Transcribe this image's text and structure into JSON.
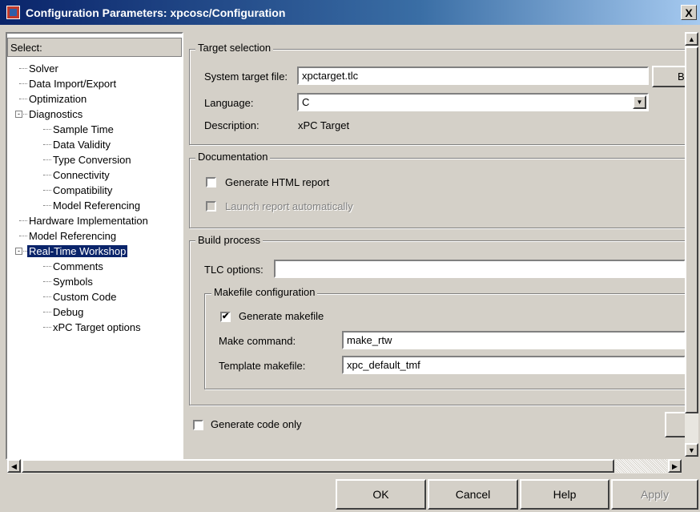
{
  "window": {
    "title": "Configuration Parameters: xpcosc/Configuration",
    "close_label": "X"
  },
  "tree": {
    "header": "Select:",
    "nodes": [
      {
        "label": "Solver"
      },
      {
        "label": "Data Import/Export"
      },
      {
        "label": "Optimization"
      },
      {
        "label": "Diagnostics",
        "expander": "-"
      },
      {
        "label": "Sample Time"
      },
      {
        "label": "Data Validity"
      },
      {
        "label": "Type Conversion"
      },
      {
        "label": "Connectivity"
      },
      {
        "label": "Compatibility"
      },
      {
        "label": "Model Referencing"
      },
      {
        "label": "Hardware Implementation"
      },
      {
        "label": "Model Referencing"
      },
      {
        "label": "Real-Time Workshop",
        "expander": "-",
        "selected": true
      },
      {
        "label": "Comments"
      },
      {
        "label": "Symbols"
      },
      {
        "label": "Custom Code"
      },
      {
        "label": "Debug"
      },
      {
        "label": "xPC Target options"
      }
    ]
  },
  "target_selection": {
    "legend": "Target selection",
    "system_target_label": "System target file:",
    "system_target_value": "xpctarget.tlc",
    "browse_label": "Br",
    "language_label": "Language:",
    "language_value": "C",
    "description_label": "Description:",
    "description_value": "xPC Target"
  },
  "documentation": {
    "legend": "Documentation",
    "generate_html_label": "Generate HTML report",
    "generate_html_checked": false,
    "launch_report_label": "Launch report automatically",
    "launch_report_checked": false
  },
  "build_process": {
    "legend": "Build process",
    "tlc_options_label": "TLC options:",
    "tlc_options_value": "",
    "makefile": {
      "legend": "Makefile configuration",
      "generate_makefile_label": "Generate makefile",
      "generate_makefile_mark": "✔",
      "make_command_label": "Make command:",
      "make_command_value": "make_rtw",
      "template_label": "Template makefile:",
      "template_value": "xpc_default_tmf"
    }
  },
  "generate_code_only_label": "Generate code only",
  "buttons": {
    "ok": "OK",
    "cancel": "Cancel",
    "help": "Help",
    "apply": "Apply"
  },
  "icons": {
    "scroll_left": "◀",
    "scroll_right": "▶",
    "scroll_up": "▲",
    "scroll_down": "▼",
    "dropdown": "▼"
  }
}
